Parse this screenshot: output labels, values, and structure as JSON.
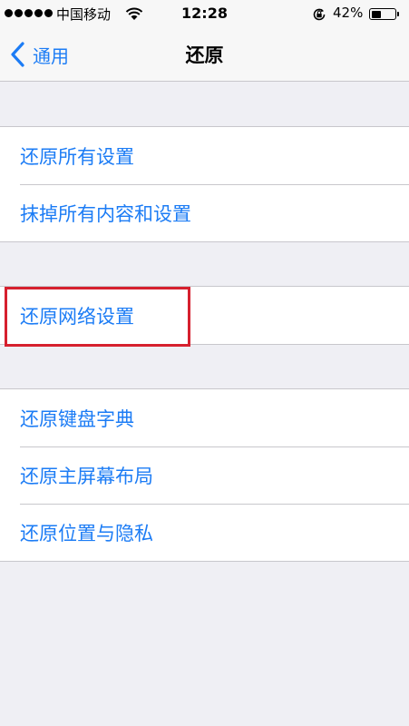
{
  "status_bar": {
    "carrier": "中国移动",
    "time": "12:28",
    "battery_percent": "42%",
    "battery_level": 0.42,
    "signal_bars": 5
  },
  "nav": {
    "back_label": "通用",
    "title": "还原"
  },
  "groups": [
    {
      "items": [
        {
          "label": "还原所有设置"
        },
        {
          "label": "抹掉所有内容和设置"
        }
      ]
    },
    {
      "items": [
        {
          "label": "还原网络设置"
        }
      ]
    },
    {
      "items": [
        {
          "label": "还原键盘字典"
        },
        {
          "label": "还原主屏幕布局"
        },
        {
          "label": "还原位置与隐私"
        }
      ]
    }
  ],
  "colors": {
    "accent": "#1c7cf5",
    "highlight": "#d6202e",
    "background": "#efeff4"
  },
  "icons": [
    "wifi-icon",
    "rotation-lock-icon",
    "battery-icon",
    "back-chevron-icon"
  ]
}
